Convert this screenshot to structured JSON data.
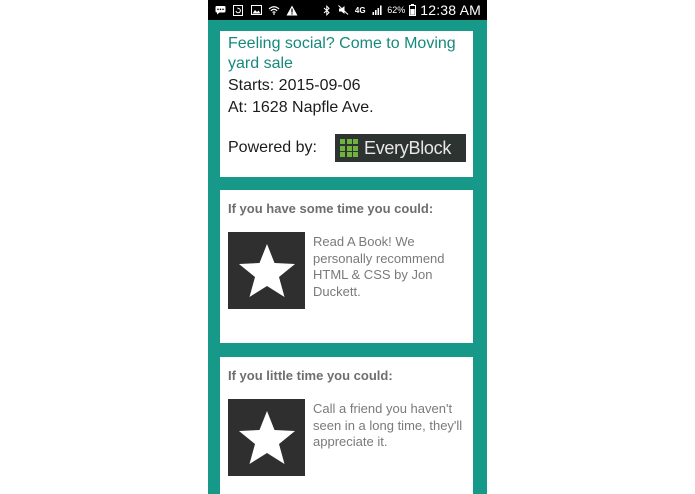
{
  "status_bar": {
    "icons": [
      "message-icon",
      "refresh-icon",
      "image-icon",
      "wifi-icon",
      "warning-icon",
      "bluetooth-icon",
      "mute-icon",
      "lte-icon",
      "signal-icon"
    ],
    "lte_label": "4G",
    "battery_percent": "62%",
    "time": "12:38 AM"
  },
  "event": {
    "title": "Feeling social? Come to Moving yard sale",
    "starts": "Starts: 2015-09-06",
    "location": "At: 1628 Napfle Ave.",
    "powered_by": "Powered by:",
    "logo_text": "EveryBlock"
  },
  "suggestions": [
    {
      "heading": "If you have some time you could:",
      "icon": "star-icon",
      "text": "Read A Book! We personally recommend HTML & CSS by Jon Duckett."
    },
    {
      "heading": "If you little time you could:",
      "icon": "star-icon",
      "text": "Call a friend you haven't seen in a long time, they'll appreciate it."
    }
  ],
  "colors": {
    "background_teal": "#17998a",
    "title_teal": "#17897c",
    "logo_green": "#6fb23e",
    "logo_bg": "#2d3331",
    "star_tile": "#2f2f2f"
  }
}
